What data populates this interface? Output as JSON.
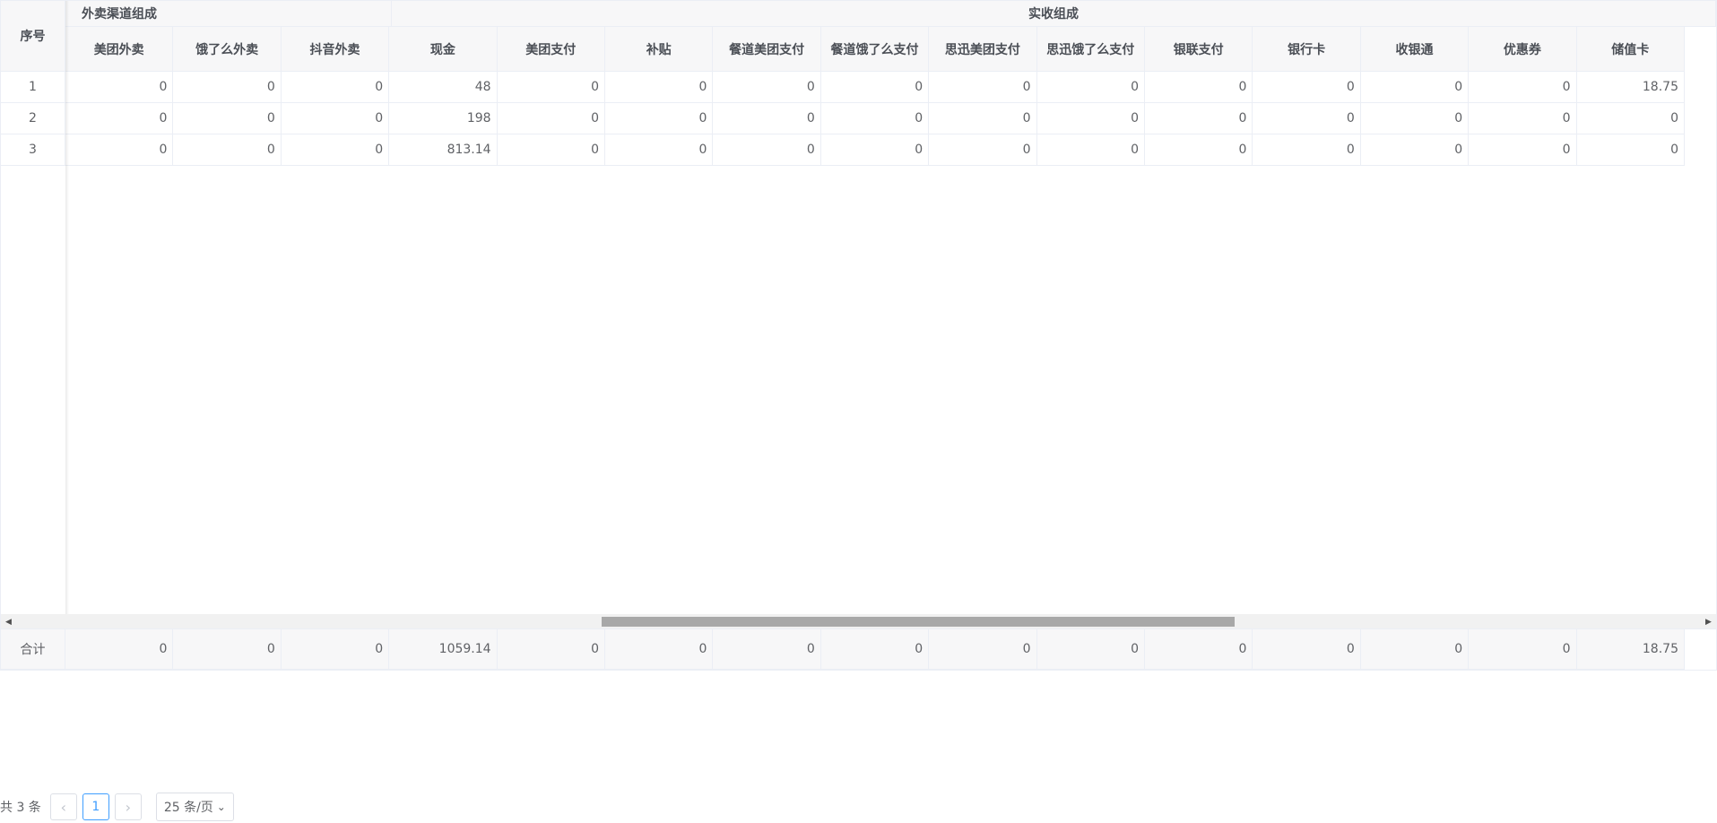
{
  "table": {
    "seq_header": "序号",
    "group_takeout": "外卖渠道组成",
    "group_actual": "实收组成",
    "columns": [
      "美团外卖",
      "饿了么外卖",
      "抖音外卖",
      "现金",
      "美团支付",
      "补贴",
      "餐道美团支付",
      "餐道饿了么支付",
      "思迅美团支付",
      "思迅饿了么支付",
      "银联支付",
      "银行卡",
      "收银通",
      "优惠券",
      "储值卡"
    ],
    "rows": [
      {
        "seq": "1",
        "values": [
          "0",
          "0",
          "0",
          "48",
          "0",
          "0",
          "0",
          "0",
          "0",
          "0",
          "0",
          "0",
          "0",
          "0",
          "18.75"
        ]
      },
      {
        "seq": "2",
        "values": [
          "0",
          "0",
          "0",
          "198",
          "0",
          "0",
          "0",
          "0",
          "0",
          "0",
          "0",
          "0",
          "0",
          "0",
          "0"
        ]
      },
      {
        "seq": "3",
        "values": [
          "0",
          "0",
          "0",
          "813.14",
          "0",
          "0",
          "0",
          "0",
          "0",
          "0",
          "0",
          "0",
          "0",
          "0",
          "0"
        ]
      }
    ],
    "footer": {
      "label": "合计",
      "values": [
        "0",
        "0",
        "0",
        "1059.14",
        "0",
        "0",
        "0",
        "0",
        "0",
        "0",
        "0",
        "0",
        "0",
        "0",
        "18.75"
      ]
    }
  },
  "scrollbar": {
    "left_arrow": "◀",
    "right_arrow": "▶"
  },
  "pagination": {
    "total_text": "共 3 条",
    "prev_icon": "‹",
    "current_page": "1",
    "next_icon": "›",
    "page_size": "25 条/页",
    "dropdown_icon": "⌄"
  },
  "colors": {
    "header_bg": "#f7f7f8",
    "border": "#ebeef5",
    "accent": "#409eff"
  }
}
